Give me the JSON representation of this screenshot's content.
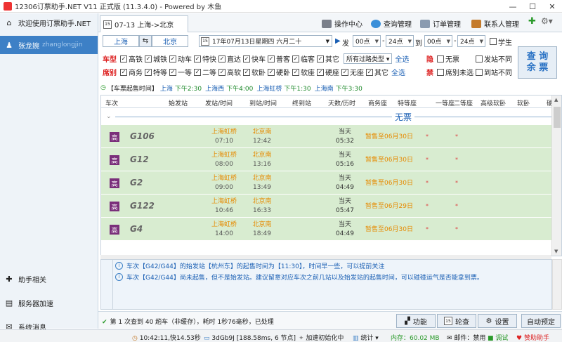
{
  "window": {
    "title": "12306订票助手.NET V11 正式版 (11.3.4.0) - Powered by 木鱼"
  },
  "sidebar": {
    "welcome": "欢迎使用订票助手.NET",
    "user": {
      "name": "张龙婉",
      "account": "zhanglongjin"
    },
    "bottom": [
      {
        "label": "助手相关"
      },
      {
        "label": "服务器加速"
      },
      {
        "label": "系统消息"
      }
    ]
  },
  "tab": {
    "cal": "15",
    "label": "07-13 上海->北京"
  },
  "menu": {
    "ops": "操作中心",
    "query_mgmt": "查询管理",
    "order_mgmt": "订单管理",
    "contacts": "联系人管理"
  },
  "query": {
    "from": "上海",
    "swap": "⇆",
    "to": "北京",
    "date": "17年07月13日星期四 六月二十",
    "date_cal": "15",
    "dep_label": "发",
    "dep_from": "00点",
    "dep_to": "24点",
    "arr_label": "到",
    "arr_from": "00点",
    "arr_to": "24点",
    "student": "学生"
  },
  "filters": {
    "type_label": "车型",
    "types": [
      "高铁",
      "城铁",
      "动车",
      "特快",
      "直达",
      "快车",
      "普客",
      "临客",
      "其它"
    ],
    "all_stations": "所有过路类型",
    "select_all": "全选",
    "seat_label": "席别",
    "seats": [
      "商务",
      "特等",
      "一等",
      "二等",
      "高软",
      "软卧",
      "硬卧",
      "软座",
      "硬座",
      "无座",
      "其它"
    ],
    "select_all2": "全选"
  },
  "flags": {
    "mark1": "隐",
    "no_ticket": "无票",
    "diff_dep": "发站不同",
    "mark2": "禁",
    "seat_unselected": "席别未选",
    "diff_arr": "到站不同"
  },
  "query_button": {
    "line1": "查 询",
    "line2": "余 票"
  },
  "notice": {
    "prefix": "【车票起售时间】",
    "items": [
      {
        "city": "上海",
        "time": "下午2:30"
      },
      {
        "city": "上海西",
        "time": "下午4:00"
      },
      {
        "city": "上海虹桥",
        "time": "下午1:30"
      },
      {
        "city": "上海南",
        "time": "下午3:30"
      }
    ]
  },
  "table": {
    "headers": [
      "车次",
      "始发站",
      "发站/时间",
      "到站/时间",
      "终到站",
      "天数/历时",
      "商务座",
      "特等座",
      "一等座",
      "二等座",
      "高级软卧",
      "软卧",
      "硬"
    ],
    "group_title": "无票",
    "rows": [
      {
        "type": "高",
        "train": "G106",
        "from": "上海虹桥",
        "dep": "07:10",
        "to": "北京南",
        "arr": "12:42",
        "day": "当天",
        "dur": "05:32",
        "status": "暂售至06月30日",
        "s1": "*",
        "s2": "*"
      },
      {
        "type": "高",
        "train": "G12",
        "from": "上海虹桥",
        "dep": "08:00",
        "to": "北京南",
        "arr": "13:16",
        "day": "当天",
        "dur": "05:16",
        "status": "暂售至06月30日",
        "s1": "*",
        "s2": "*"
      },
      {
        "type": "高",
        "train": "G2",
        "from": "上海虹桥",
        "dep": "09:00",
        "to": "北京南",
        "arr": "13:49",
        "day": "当天",
        "dur": "04:49",
        "status": "暂售至06月30日",
        "s1": "*",
        "s2": "*"
      },
      {
        "type": "高",
        "train": "G122",
        "from": "上海虹桥",
        "dep": "10:46",
        "to": "北京南",
        "arr": "16:33",
        "day": "当天",
        "dur": "05:47",
        "status": "暂售至06月29日",
        "s1": "*",
        "s2": "*"
      },
      {
        "type": "高",
        "train": "G4",
        "from": "上海虹桥",
        "dep": "14:00",
        "to": "北京南",
        "arr": "18:49",
        "day": "当天",
        "dur": "04:49",
        "status": "暂售至06月30日",
        "s1": "*",
        "s2": "*"
      }
    ]
  },
  "tips": [
    "车次【G42/G44】的始发站【杭州东】的起售时间为【11:30】，时间早一些，可以提前关注",
    "车次【G42/G44】尚未起售，但不是始发站。建议留意对应车次之前几站以及始发站的起售时间，可以碰碰运气是否能拿到票。"
  ],
  "status": {
    "msg": "第 1 次查到 40 趟车（非缓存），耗时 1秒76毫秒，已处理",
    "btn_func": "功能",
    "btn_poll": "轮查",
    "btn_settings": "设置",
    "btn_auto": "自动预定",
    "time": "10:42:11,快14.53秒",
    "server": "3dGb9J [188.58ms, 6 节点]",
    "accel": "加速初始化中",
    "stats": "统计",
    "memory": "内存：60.02 MB",
    "mail": "邮件：禁用",
    "debug": "调试",
    "support": "赞助助手"
  },
  "colors": {
    "accent": "#3d80c6",
    "row_green": "#d8ecd0",
    "orange": "#e68a00",
    "badge": "#7a2f7a"
  }
}
